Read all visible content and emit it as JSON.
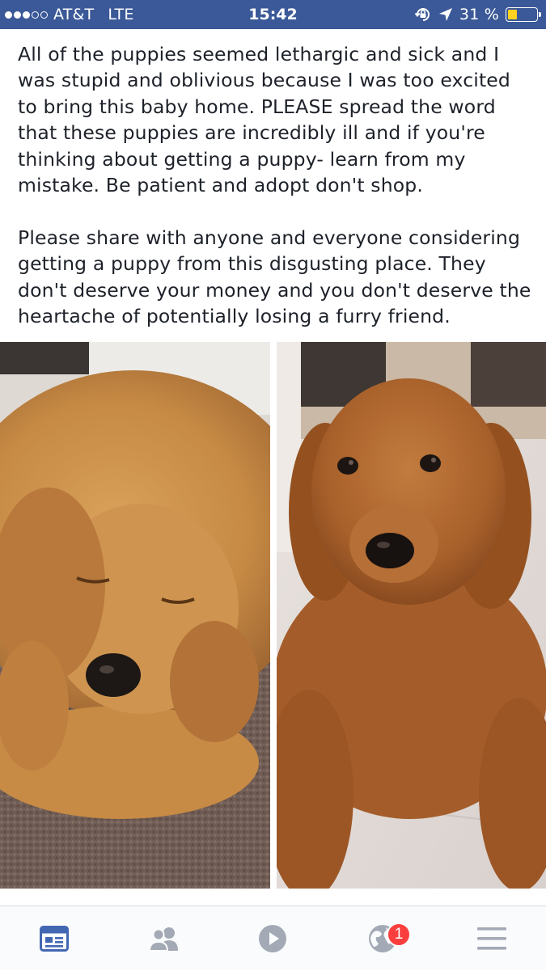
{
  "status_bar": {
    "carrier": "AT&T",
    "network": "LTE",
    "time": "15:42",
    "battery_percent": "31 %",
    "battery_level": 0.31,
    "signal_bars_filled": 3,
    "signal_bars_total": 5,
    "background_color": "#3b5998",
    "battery_color": "#ffd21f",
    "icons": [
      "rotation-lock-icon",
      "location-arrow-icon",
      "battery-icon"
    ]
  },
  "post": {
    "paragraphs": [
      "All of the puppies seemed lethargic and sick and I was stupid and oblivious because I was too excited to bring this baby home. PLEASE spread the word that these puppies are incredibly ill and if you're thinking about getting a puppy- learn from my mistake. Be patient and adopt don't shop.",
      "Please share with anyone and everyone considering getting a puppy from this disgusting place. They don't deserve your money and you don't deserve the heartache of potentially losing a furry friend."
    ],
    "photos": [
      {
        "subject": "sleeping golden retriever puppy on carpet"
      },
      {
        "subject": "golden retriever puppy lying on tile floor looking at camera"
      }
    ]
  },
  "tab_bar": {
    "tabs": [
      {
        "icon": "news-feed-icon",
        "active": true
      },
      {
        "icon": "friends-icon",
        "active": false
      },
      {
        "icon": "video-play-icon",
        "active": false
      },
      {
        "icon": "notifications-globe-icon",
        "active": false,
        "badge": "1"
      },
      {
        "icon": "menu-icon",
        "active": false
      }
    ],
    "active_color": "#4267b2",
    "inactive_color": "#a3a9b5",
    "badge_color": "#fa3e3e"
  }
}
